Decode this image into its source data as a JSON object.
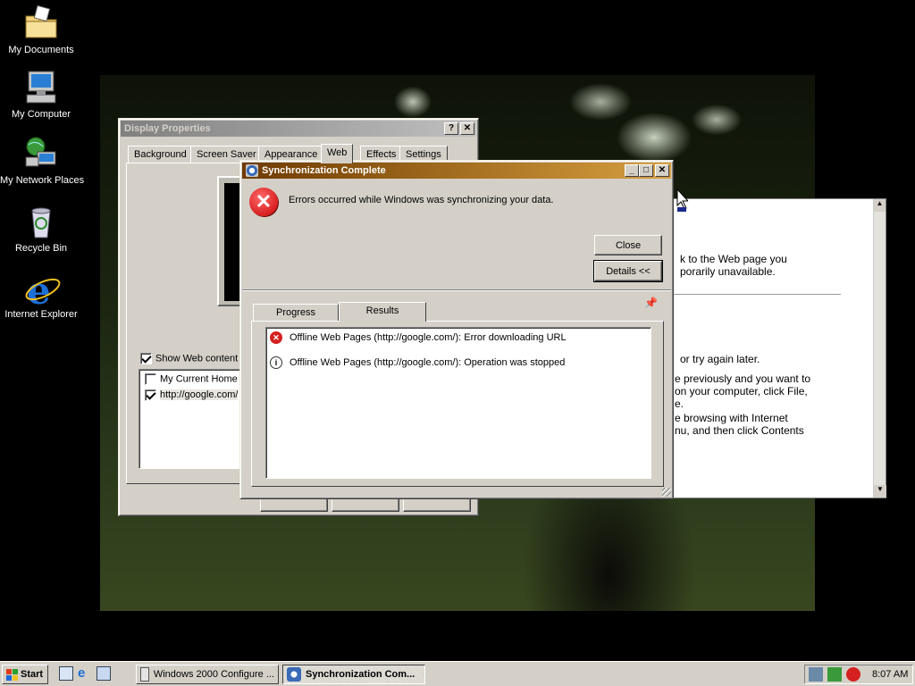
{
  "desktop": {
    "icons": [
      {
        "label": "My Documents",
        "icon": "folder-icon"
      },
      {
        "label": "My Computer",
        "icon": "computer-icon"
      },
      {
        "label": "My Network Places",
        "icon": "network-icon"
      },
      {
        "label": "Recycle Bin",
        "icon": "recycle-bin-icon"
      },
      {
        "label": "Internet Explorer",
        "icon": "ie-icon"
      }
    ]
  },
  "display_properties": {
    "title": "Display Properties",
    "tabs": [
      "Background",
      "Screen Saver",
      "Appearance",
      "Web",
      "Effects",
      "Settings"
    ],
    "selected_tab": "Web",
    "show_web_content_label": "Show Web content",
    "web_items": [
      {
        "label": "My Current Home P",
        "checked": false
      },
      {
        "label": "http://google.com/",
        "checked": true
      }
    ]
  },
  "ie_page": {
    "lines": [
      "k to the Web page you",
      "porarily unavailable.",
      "or try again later.",
      "e previously and you want to",
      "on your computer, click File,",
      "e.",
      "e browsing with Internet",
      "nu, and then click Contents"
    ]
  },
  "sync_dialog": {
    "title": "Synchronization Complete",
    "message": "Errors occurred while Windows was synchronizing your data.",
    "close_label": "Close",
    "details_label": "Details <<",
    "tabs": [
      "Progress",
      "Results"
    ],
    "selected_tab": "Results",
    "results": [
      {
        "status": "error",
        "text": "Offline Web Pages (http://google.com/): Error downloading URL"
      },
      {
        "status": "info",
        "text": "Offline Web Pages (http://google.com/): Operation was stopped"
      }
    ]
  },
  "taskbar": {
    "start_label": "Start",
    "tasks": [
      {
        "label": "Windows 2000 Configure ...",
        "active": false
      },
      {
        "label": "Synchronization Com...",
        "active": true
      }
    ],
    "clock": "8:07 AM"
  },
  "colors": {
    "active_title_start": "#6e3a00",
    "active_title_end": "#d8a040",
    "window_face": "#d4d0c8",
    "error_red": "#d42020"
  }
}
